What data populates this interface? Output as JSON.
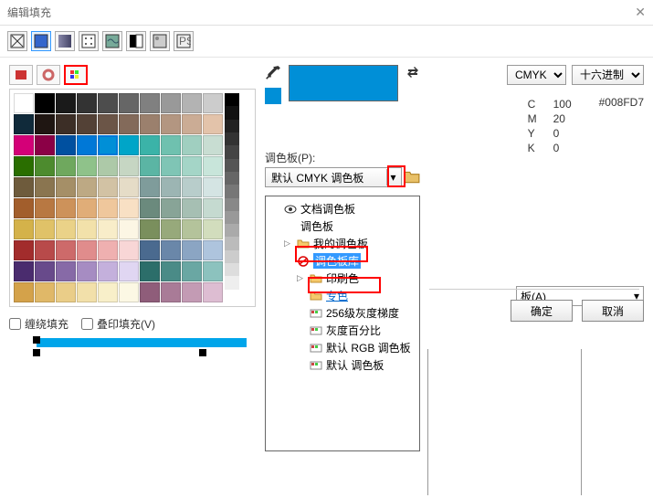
{
  "title": "编辑填充",
  "fill_types": [
    "no-fill",
    "solid",
    "gradient",
    "pattern",
    "texture",
    "two-color",
    "bitmap",
    "postscript"
  ],
  "model_tabs": [
    "mixer",
    "wheel",
    "palette"
  ],
  "palette_colors": [
    "#ffffff",
    "#000000",
    "#1a1a1a",
    "#333333",
    "#4d4d4d",
    "#666666",
    "#808080",
    "#999999",
    "#b3b3b3",
    "#cccccc",
    "#102a3a",
    "#1f1612",
    "#3c2e26",
    "#534136",
    "#6b5547",
    "#836a5a",
    "#9b806d",
    "#b39681",
    "#cbac95",
    "#e3c3aa",
    "#d40078",
    "#8b0046",
    "#0050a0",
    "#0078d7",
    "#008FD7",
    "#00a5c8",
    "#3bb3a8",
    "#6fc1af",
    "#a0cfc0",
    "#c8ddd2",
    "#2a6e00",
    "#4d8b2e",
    "#6fa85e",
    "#8fc28a",
    "#adc9a8",
    "#c6d6c3",
    "#5bb5a4",
    "#7fc5b5",
    "#a4d5c7",
    "#c8e5da",
    "#6e5b3c",
    "#8a7550",
    "#a58f67",
    "#bda984",
    "#d2c2a4",
    "#e5dcc7",
    "#7f9c9b",
    "#9cb5b3",
    "#b8cdcb",
    "#d4e4e3",
    "#a25e2c",
    "#b87842",
    "#cd925a",
    "#e0ad78",
    "#efc79c",
    "#f8e0c4",
    "#6b8a7d",
    "#88a497",
    "#a6bfb3",
    "#c5dad0",
    "#d4b24a",
    "#e0c268",
    "#ead288",
    "#f2e1aa",
    "#f8edc9",
    "#fcf6e4",
    "#7a8f5d",
    "#97a97b",
    "#b4c39b",
    "#d2ddbd",
    "#a22c2c",
    "#b84a4a",
    "#cd6a6a",
    "#e08c8c",
    "#efb0b0",
    "#f8d6d6",
    "#4a6a8f",
    "#6a87a9",
    "#8ba5c3",
    "#aec4dd",
    "#4a2c6e",
    "#684a8b",
    "#876aa7",
    "#a68cc2",
    "#c4b0dc",
    "#e0d6f2",
    "#2c6e6a",
    "#4a8b87",
    "#6aa7a3",
    "#8cc2be",
    "#d4a24a",
    "#e0b868",
    "#eacd88",
    "#f2e0aa",
    "#f8efc9",
    "#fcf8e4",
    "#8f5d7a",
    "#a97b97",
    "#c39bb4",
    "#ddbdd2"
  ],
  "selected_swatch_index": 24,
  "ramp": [
    "#000",
    "#111",
    "#222",
    "#333",
    "#444",
    "#555",
    "#666",
    "#777",
    "#888",
    "#999",
    "#aaa",
    "#bbb",
    "#ccc",
    "#ddd",
    "#eee",
    "#fff"
  ],
  "wrap_fill_label": "缠绕填充",
  "overprint_label": "叠印填充(V)",
  "color_model": "CMYK",
  "number_format": "十六进制",
  "cmyk": {
    "C": 100,
    "M": 20,
    "Y": 0,
    "K": 0
  },
  "hex": "#008FD7",
  "palette_label": "调色板(P):",
  "palette_selected": "默认 CMYK 调色板",
  "name_label": "板(A)",
  "dropdown": {
    "items": [
      {
        "icon": "eye",
        "label": "文档调色板",
        "indent": 0
      },
      {
        "icon": "none",
        "label": "调色板",
        "indent": 0
      },
      {
        "icon": "folder",
        "label": "我的调色板",
        "indent": 1,
        "tri": true
      },
      {
        "icon": "forbid",
        "label": "调色板库",
        "indent": 1,
        "hl": true,
        "outline": true
      },
      {
        "icon": "folder",
        "label": "印刷色",
        "indent": 2,
        "tri": true
      },
      {
        "icon": "folder",
        "label": "专色",
        "indent": 2,
        "outline": true,
        "blue": true
      },
      {
        "icon": "pal",
        "label": "256级灰度梯度",
        "indent": 2
      },
      {
        "icon": "pal",
        "label": "灰度百分比",
        "indent": 2
      },
      {
        "icon": "pal",
        "label": "默认 RGB 调色板",
        "indent": 2
      },
      {
        "icon": "pal",
        "label": "默认 调色板",
        "indent": 2
      }
    ]
  },
  "ok_label": "确定",
  "cancel_label": "取消"
}
